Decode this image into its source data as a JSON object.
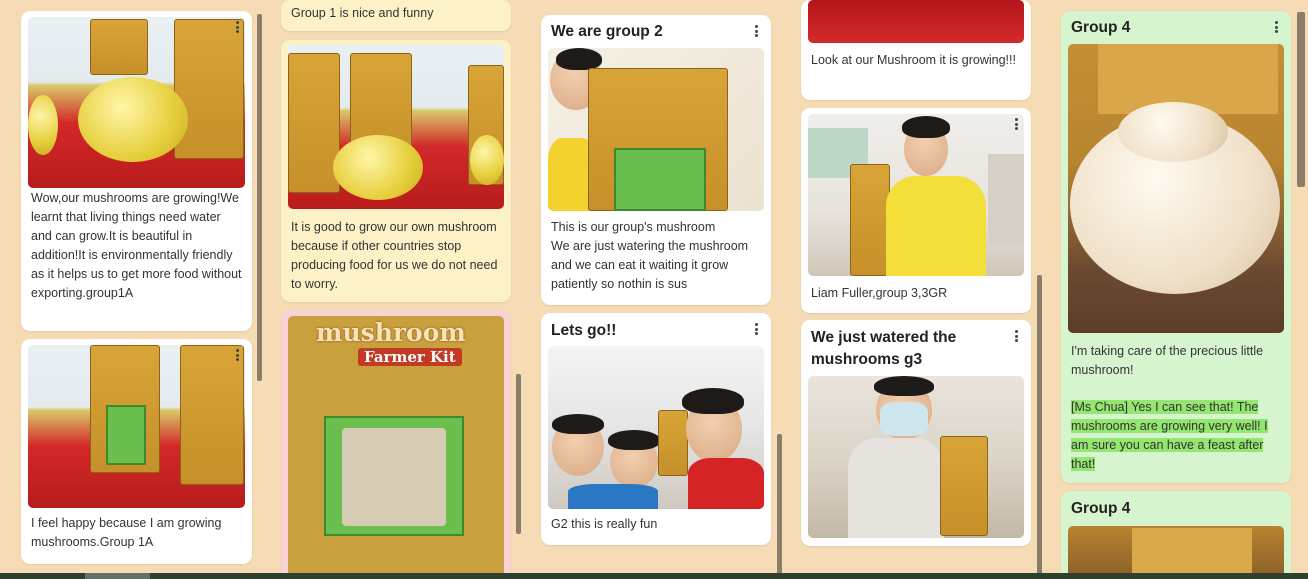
{
  "colors": {
    "background": "#f6dcb4",
    "card_white": "#ffffff",
    "card_yellow": "#fdf1c8",
    "card_green": "#d6f5cf",
    "card_pink": "#f9d3d8",
    "highlight": "#93e66f"
  },
  "columns": [
    {
      "cards": [
        {
          "text": "Wow,our mushrooms are growing!We learnt that living things need water and can grow.It is beautiful in addition!It is environmentally friendly as it helps us to get more food without exporting.group1A"
        },
        {
          "text": "I feel happy because I am growing mushrooms.Group 1A"
        }
      ]
    },
    {
      "cards": [
        {
          "text": "Group 1 is nice and funny"
        },
        {
          "text": "It is good to grow our own mushroom because if other countries stop producing food for us we do not need to worry."
        },
        {
          "image_text": "mushroom",
          "image_subtext": "Farmer Kit"
        }
      ]
    },
    {
      "cards": [
        {
          "title": "We are group 2",
          "text": "This is our group's mushroom\nWe are just watering the mushroom and we can eat it waiting it grow patiently so nothin is sus"
        },
        {
          "title": "Lets go!!",
          "text": "G2 this is really fun"
        }
      ]
    },
    {
      "cards": [
        {
          "text": "Look at our Mushroom it is growing!!!"
        },
        {
          "text": "Liam Fuller,group 3,3GR"
        },
        {
          "title": "We just watered the mushrooms g3"
        }
      ]
    },
    {
      "cards": [
        {
          "title": "Group 4",
          "text": "I'm taking care of the precious little mushroom!",
          "comment": "[Ms Chua] Yes I can see that! The mushrooms are growing very well! I am sure you can have a feast after that!"
        },
        {
          "title": "Group 4"
        }
      ]
    }
  ]
}
